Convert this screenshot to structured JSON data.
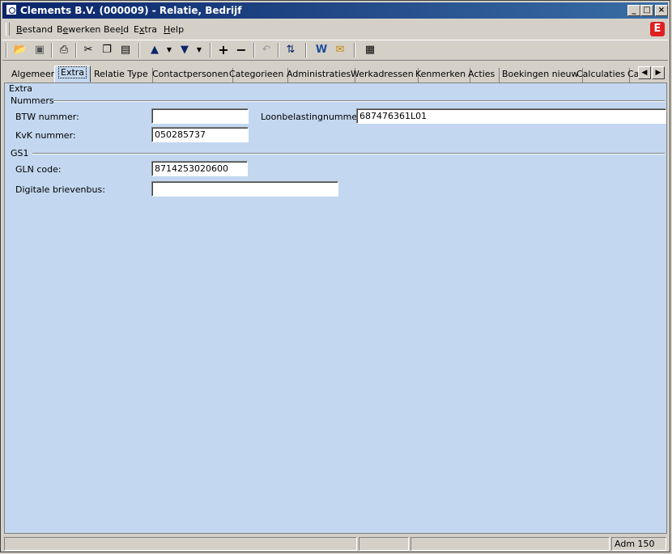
{
  "window": {
    "title": "Clements B.V. (000009) - Relatie, Bedrijf"
  },
  "menu": {
    "items": [
      {
        "label": "Bestand",
        "mnemonic": "B"
      },
      {
        "label": "Bewerken",
        "mnemonic": "e"
      },
      {
        "label": "Beeld",
        "mnemonic": "l"
      },
      {
        "label": "Extra",
        "mnemonic": "x"
      },
      {
        "label": "Help",
        "mnemonic": "H"
      }
    ]
  },
  "logo": {
    "letter": "E",
    "color": "#e02020"
  },
  "toolbar": {
    "icons": [
      "open-folder-icon",
      "save-icon",
      "print-icon",
      "cut-icon",
      "copy-icon",
      "paste-icon",
      "arrow-up-icon",
      "dropdown-icon",
      "arrow-down-icon",
      "dropdown-icon",
      "add-icon",
      "remove-icon",
      "undo-icon",
      "refresh-icon",
      "word-icon",
      "mail-icon",
      "layout-icon"
    ]
  },
  "tabs": [
    "Algemeen",
    "Extra",
    "Relatie Type",
    "Contactpersonen",
    "Categorieen",
    "Administraties",
    "Werkadressen",
    "Kenmerken",
    "Acties",
    "Boekingen nieuw",
    "Calculaties",
    "Ca"
  ],
  "active_tab": "Extra",
  "panel": {
    "header": "Extra",
    "groups": {
      "nummers": "Nummers",
      "gs1": "GS1"
    },
    "fields": {
      "btw_label": "BTW nummer:",
      "btw_value": "",
      "loonbelasting_label": "Loonbelastingnummer:",
      "loonbelasting_value": "687476361L01",
      "kvk_label": "KvK nummer:",
      "kvk_value": "050285737",
      "gln_label": "GLN code:",
      "gln_value": "8714253020600",
      "brievenbus_label": "Digitale brievenbus:",
      "brievenbus_value": ""
    }
  },
  "status": {
    "adm": "Adm 150"
  },
  "colors": {
    "panel_bg": "#c3d8f0",
    "title_bg": "#0a246a"
  }
}
